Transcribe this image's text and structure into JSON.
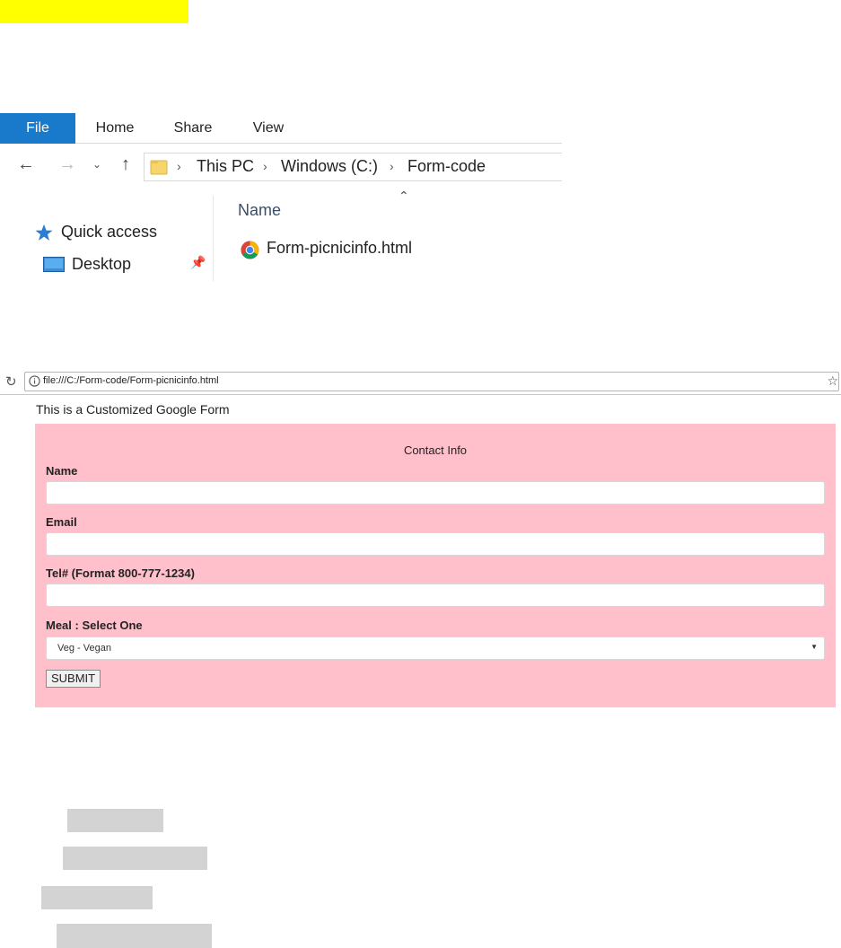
{
  "explorer": {
    "tabs": [
      "File",
      "Home",
      "Share",
      "View"
    ],
    "breadcrumb": [
      "This PC",
      "Windows (C:)",
      "Form-code"
    ],
    "nav_pane": {
      "quick_access": "Quick access",
      "desktop": "Desktop"
    },
    "column_header": "Name",
    "files": [
      {
        "name": "Form-picnicinfo.html",
        "icon": "chrome-icon"
      }
    ]
  },
  "browser": {
    "url": "file:///C:/Form-code/Form-picnicinfo.html"
  },
  "page": {
    "heading": "This is a Customized Google Form",
    "form": {
      "title": "Contact Info",
      "fields": {
        "name_label": "Name",
        "email_label": "Email",
        "tel_label": "Tel# (Format 800-777-1234)",
        "meal_label": "Meal : Select One",
        "meal_value": "Veg - Vegan"
      },
      "submit_label": "SUBMIT"
    }
  },
  "colors": {
    "file_tab": "#1979ca",
    "form_background": "#ffc0cb",
    "highlight_yellow": "#ffff00",
    "highlight_grey": "#d3d3d3"
  }
}
